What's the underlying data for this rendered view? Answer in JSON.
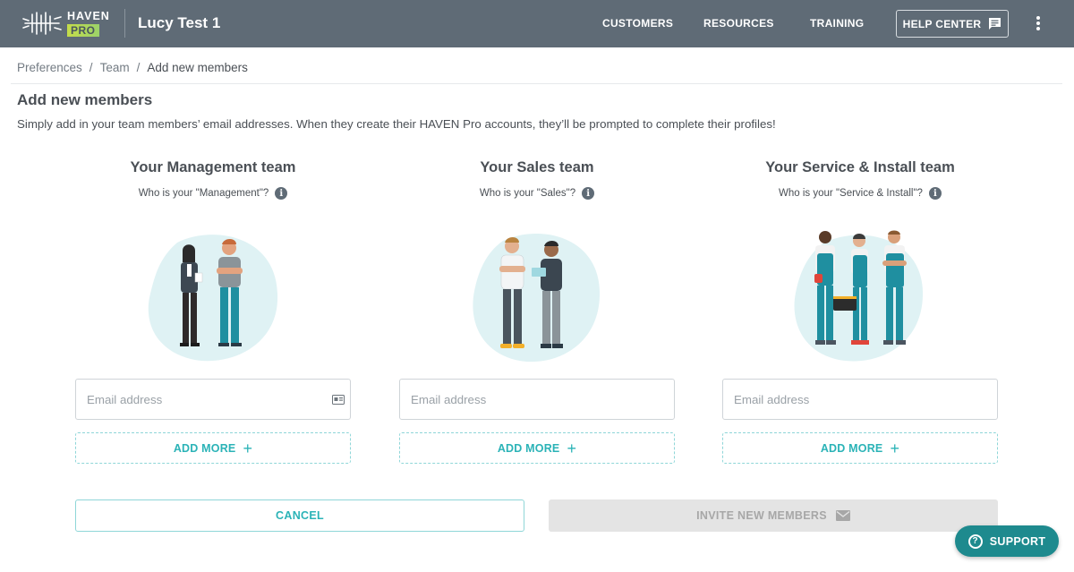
{
  "header": {
    "logo_top": "HAVEN",
    "logo_bottom": "PRO",
    "app_title": "Lucy Test 1",
    "nav": [
      "CUSTOMERS",
      "RESOURCES",
      "TRAINING"
    ],
    "help_label": "HELP CENTER"
  },
  "breadcrumb": {
    "items": [
      "Preferences",
      "Team",
      "Add new members"
    ],
    "separator": "/"
  },
  "page": {
    "title": "Add new members",
    "description": "Simply add in your team members’ email addresses. When they create their HAVEN Pro accounts, they’ll be prompted to complete their profiles!"
  },
  "teams": [
    {
      "title": "Your Management team",
      "question": "Who is your \"Management\"?",
      "email_placeholder": "Email address",
      "add_more": "ADD MORE"
    },
    {
      "title": "Your Sales team",
      "question": "Who is your \"Sales\"?",
      "email_placeholder": "Email address",
      "add_more": "ADD MORE"
    },
    {
      "title": "Your Service & Install team",
      "question": "Who is your \"Service & Install\"?",
      "email_placeholder": "Email address",
      "add_more": "ADD MORE"
    }
  ],
  "actions": {
    "cancel": "CANCEL",
    "invite": "INVITE NEW MEMBERS",
    "support": "SUPPORT"
  },
  "colors": {
    "header_bg": "#5f6b76",
    "accent_teal": "#2bb3b7",
    "support_bg": "#1e8a8e",
    "disabled_bg": "#e4e4e4"
  }
}
